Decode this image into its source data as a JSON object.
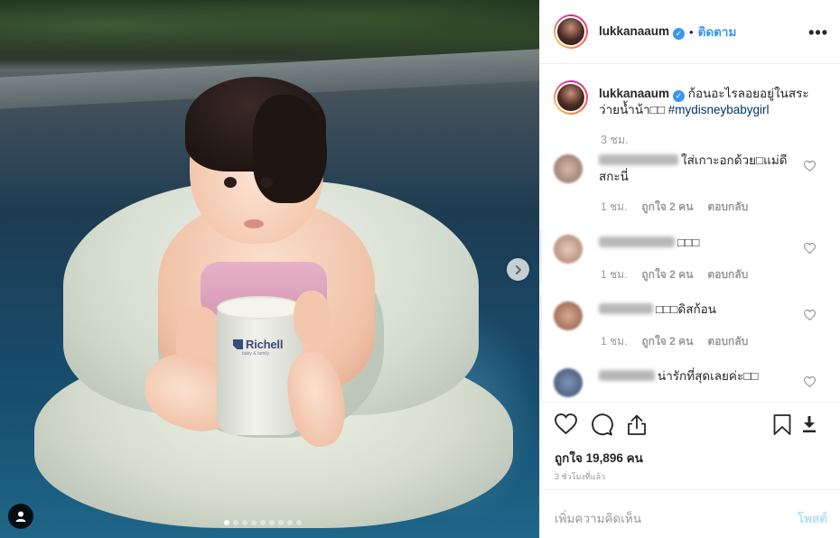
{
  "post": {
    "username": "lukkanaaum",
    "separator": "•",
    "follow_label": "ติดตาม",
    "more_label": "•••",
    "verified_glyph": "✓"
  },
  "photo": {
    "brand_text": "Richell",
    "brand_sub": "baby & family",
    "carousel_count": 9,
    "carousel_active_index": 0
  },
  "caption": {
    "username": "lukkanaaum",
    "text": " ก้อนอะไรลอยอยู่ในสระว่ายน้ำน้า□□ ",
    "hashtag": "#mydisneybabygirl",
    "time": "3 ชม."
  },
  "comments": [
    {
      "text": "ใส่เกาะอกด้วย□แม่ดีสกะนี่",
      "time": "1 ชม.",
      "likes": "ถูกใจ 2 คน",
      "reply": "ตอบกลับ"
    },
    {
      "text": "□□□",
      "time": "1 ชม.",
      "likes": "ถูกใจ 2 คน",
      "reply": "ตอบกลับ"
    },
    {
      "text": "□□□ดิสก้อน",
      "time": "1 ชม.",
      "likes": "ถูกใจ 2 คน",
      "reply": "ตอบกลับ"
    },
    {
      "text": "น่ารักที่สุดเลยค่ะ□□",
      "time": "",
      "likes": "",
      "reply": ""
    }
  ],
  "actions": {
    "likes_text": "ถูกใจ 19,896 คน",
    "post_time": "3 ชั่วโมงที่แล้ว"
  },
  "add_comment": {
    "placeholder": "เพิ่มความคิดเห็น",
    "post_label": "โพสต์"
  },
  "colors": {
    "link_blue": "#3897f0",
    "hashtag": "#003569",
    "muted": "#999999",
    "post_disabled": "#b2dffc"
  }
}
